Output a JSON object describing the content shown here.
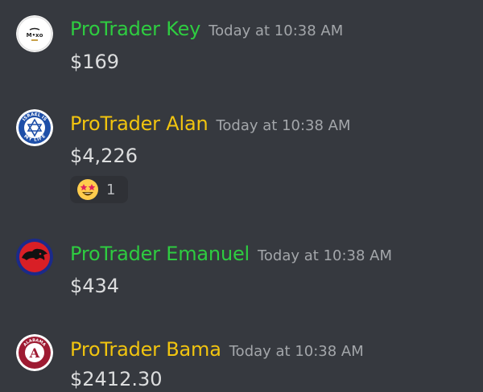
{
  "colors": {
    "background": "#36393f",
    "green_name": "#2ecc40",
    "gold_name": "#f1c40f",
    "timestamp": "#a3a6aa",
    "message_text": "#dcddde"
  },
  "messages": [
    {
      "username": "ProTrader Key",
      "name_color": "green",
      "timestamp": "Today at 10:38 AM",
      "content": "$169",
      "avatar_icon": "golf-ball-logo-icon"
    },
    {
      "username": "ProTrader Alan",
      "name_color": "gold",
      "timestamp": "Today at 10:38 AM",
      "content": "$4,226",
      "avatar_icon": "israel-is-my-life-badge-icon",
      "reaction": {
        "emoji": "star-struck-emoji-icon",
        "count": "1"
      }
    },
    {
      "username": "ProTrader Emanuel",
      "name_color": "green",
      "timestamp": "Today at 10:38 AM",
      "content": "$434",
      "avatar_icon": "thundercats-logo-icon"
    },
    {
      "username": "ProTrader Bama",
      "name_color": "gold",
      "timestamp": "Today at 10:38 AM",
      "content": "$2412.30",
      "avatar_icon": "alabama-crimson-tide-logo-icon"
    }
  ]
}
